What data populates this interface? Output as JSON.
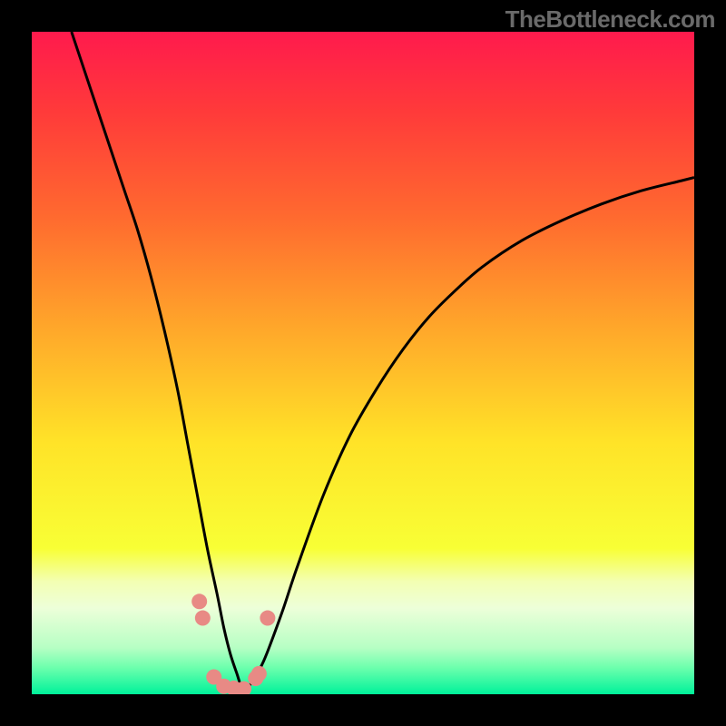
{
  "watermark": "TheBottleneck.com",
  "colors": {
    "curve": "#000000",
    "marker_fill": "#e88a85",
    "marker_stroke": "#d46d66",
    "gradient_stops": [
      {
        "offset": 0.0,
        "color": "#ff1a4d"
      },
      {
        "offset": 0.12,
        "color": "#ff3a3a"
      },
      {
        "offset": 0.28,
        "color": "#ff6a2f"
      },
      {
        "offset": 0.45,
        "color": "#ffa82a"
      },
      {
        "offset": 0.62,
        "color": "#ffe328"
      },
      {
        "offset": 0.78,
        "color": "#f8ff35"
      },
      {
        "offset": 0.83,
        "color": "#f3ffb3"
      },
      {
        "offset": 0.87,
        "color": "#edffd9"
      },
      {
        "offset": 0.93,
        "color": "#b6ffc4"
      },
      {
        "offset": 0.96,
        "color": "#6cffad"
      },
      {
        "offset": 1.0,
        "color": "#00f29a"
      }
    ]
  },
  "chart_data": {
    "type": "line",
    "title": "",
    "xlabel": "",
    "ylabel": "",
    "xlim": [
      0,
      100
    ],
    "ylim": [
      0,
      100
    ],
    "series": [
      {
        "name": "bottleneck-curve",
        "x": [
          6,
          8,
          10,
          12,
          14,
          16,
          18,
          20,
          22,
          23.5,
          25,
          26.5,
          28,
          29,
          30,
          31,
          31.5,
          32,
          33,
          34,
          35,
          36,
          38,
          40,
          44,
          48,
          52,
          56,
          60,
          64,
          68,
          74,
          80,
          86,
          92,
          98,
          100
        ],
        "y": [
          100,
          94,
          88,
          82,
          76,
          70,
          63,
          55,
          46,
          38,
          30,
          22,
          15,
          10,
          6,
          3,
          1.5,
          1,
          1.5,
          3,
          5,
          7.5,
          13,
          19,
          30,
          39,
          46,
          52,
          57,
          61,
          64.5,
          68.5,
          71.5,
          74,
          76,
          77.5,
          78
        ]
      }
    ],
    "markers": {
      "name": "highlight-points",
      "x": [
        25.3,
        25.8,
        27.5,
        29.0,
        30.5,
        32.0,
        33.8,
        34.3,
        35.6
      ],
      "y": [
        14.0,
        11.5,
        2.6,
        1.2,
        0.9,
        0.8,
        2.4,
        3.1,
        11.5
      ]
    }
  }
}
